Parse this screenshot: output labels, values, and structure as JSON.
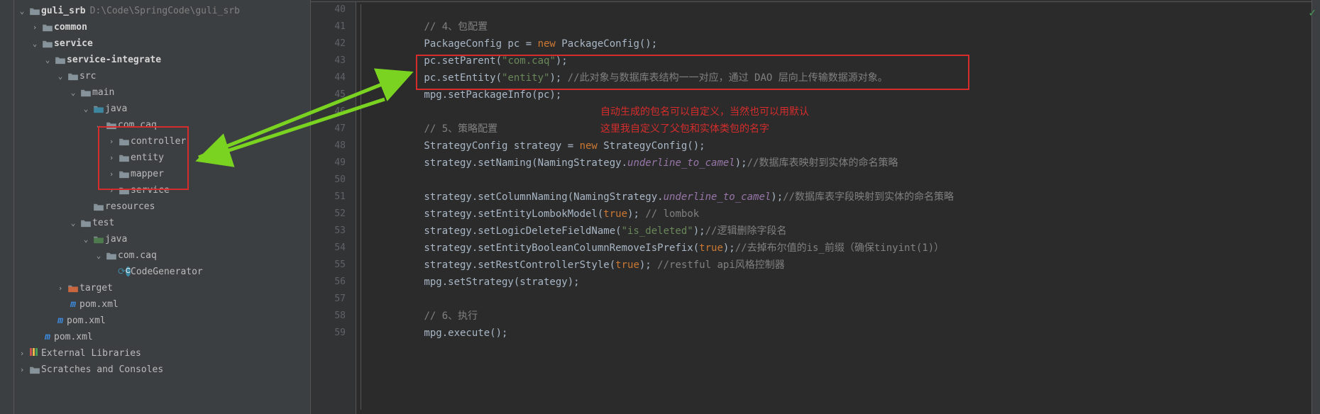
{
  "project": {
    "root_label": "guli_srb",
    "root_path": "D:\\Code\\SpringCode\\guli_srb",
    "items": [
      {
        "depth": 0,
        "arrow": "v",
        "icon": "fld",
        "bold": true,
        "label": "guli_srb",
        "extra": "D:\\Code\\SpringCode\\guli_srb"
      },
      {
        "depth": 1,
        "arrow": ">",
        "icon": "fld",
        "bold": true,
        "label": "common"
      },
      {
        "depth": 1,
        "arrow": "v",
        "icon": "fld",
        "bold": true,
        "label": "service"
      },
      {
        "depth": 2,
        "arrow": "v",
        "icon": "fld",
        "bold": true,
        "label": "service-integrate"
      },
      {
        "depth": 3,
        "arrow": "v",
        "icon": "fld",
        "label": "src"
      },
      {
        "depth": 4,
        "arrow": "v",
        "icon": "fld",
        "label": "main"
      },
      {
        "depth": 5,
        "arrow": "v",
        "icon": "fld-src",
        "label": "java"
      },
      {
        "depth": 6,
        "arrow": "v",
        "icon": "fld-pkg",
        "label": "com.caq"
      },
      {
        "depth": 7,
        "arrow": ">",
        "icon": "fld-pkg",
        "label": "controller"
      },
      {
        "depth": 7,
        "arrow": ">",
        "icon": "fld-pkg",
        "label": "entity"
      },
      {
        "depth": 7,
        "arrow": ">",
        "icon": "fld-pkg",
        "label": "mapper"
      },
      {
        "depth": 7,
        "arrow": ">",
        "icon": "fld-pkg",
        "label": "service"
      },
      {
        "depth": 5,
        "arrow": "",
        "icon": "fld",
        "label": "resources"
      },
      {
        "depth": 4,
        "arrow": "v",
        "icon": "fld",
        "label": "test"
      },
      {
        "depth": 5,
        "arrow": "v",
        "icon": "fld-test",
        "label": "java"
      },
      {
        "depth": 6,
        "arrow": "v",
        "icon": "fld-pkg",
        "label": "com.caq"
      },
      {
        "depth": 7,
        "arrow": "",
        "icon": "cls",
        "label": "CodeGenerator",
        "gear": true
      },
      {
        "depth": 3,
        "arrow": ">",
        "icon": "fld-exclude",
        "label": "target"
      },
      {
        "depth": 3,
        "arrow": "",
        "icon": "m",
        "label": "pom.xml"
      },
      {
        "depth": 2,
        "arrow": "",
        "icon": "m",
        "label": "pom.xml"
      },
      {
        "depth": 1,
        "arrow": "",
        "icon": "m",
        "label": "pom.xml"
      },
      {
        "depth": 0,
        "arrow": ">",
        "icon": "lib",
        "label": "External Libraries"
      },
      {
        "depth": 0,
        "arrow": ">",
        "icon": "scratch",
        "label": "Scratches and Consoles"
      }
    ]
  },
  "editor": {
    "first_line_no": 40,
    "lines": [
      {
        "n": 40,
        "segs": [
          [
            "",
            ""
          ]
        ]
      },
      {
        "n": 41,
        "segs": [
          [
            "k-comment",
            "// 4、包配置"
          ]
        ]
      },
      {
        "n": 42,
        "segs": [
          [
            "",
            "PackageConfig pc = "
          ],
          [
            "k-kw",
            "new "
          ],
          [
            "",
            "PackageConfig();"
          ]
        ]
      },
      {
        "n": 43,
        "segs": [
          [
            "",
            "pc.setParent("
          ],
          [
            "k-str",
            "\"com.caq\""
          ],
          [
            "",
            ");"
          ]
        ]
      },
      {
        "n": 44,
        "segs": [
          [
            "",
            "pc.setEntity("
          ],
          [
            "k-str",
            "\"entity\""
          ],
          [
            "",
            "); "
          ],
          [
            "k-comment",
            "//此对象与数据库表结构一一对应，通过 DAO 层向上传输数据源对象。"
          ]
        ]
      },
      {
        "n": 45,
        "segs": [
          [
            "",
            "mpg.setPackageInfo(pc);"
          ]
        ]
      },
      {
        "n": 46,
        "segs": [
          [
            "",
            ""
          ]
        ],
        "note_a": "自动生成的包名可以自定义，当然也可以用默认"
      },
      {
        "n": 47,
        "segs": [
          [
            "k-comment",
            "// 5、策略配置"
          ]
        ],
        "note_a": "这里我自定义了父包和实体类包的名字"
      },
      {
        "n": 48,
        "segs": [
          [
            "",
            "StrategyConfig strategy = "
          ],
          [
            "k-kw",
            "new "
          ],
          [
            "",
            "StrategyConfig();"
          ]
        ]
      },
      {
        "n": 49,
        "segs": [
          [
            "",
            "strategy.setNaming(NamingStrategy."
          ],
          [
            "k-field",
            "underline_to_camel"
          ],
          [
            "",
            ");"
          ],
          [
            "k-comment",
            "//数据库表映射到实体的命名策略"
          ]
        ]
      },
      {
        "n": 50,
        "segs": [
          [
            "",
            ""
          ]
        ]
      },
      {
        "n": 51,
        "segs": [
          [
            "",
            "strategy.setColumnNaming(NamingStrategy."
          ],
          [
            "k-field",
            "underline_to_camel"
          ],
          [
            "",
            ");"
          ],
          [
            "k-comment",
            "//数据库表字段映射到实体的命名策略"
          ]
        ]
      },
      {
        "n": 52,
        "segs": [
          [
            "",
            "strategy.setEntityLombokModel("
          ],
          [
            "k-kw",
            "true"
          ],
          [
            "",
            "); "
          ],
          [
            "k-comment",
            "// lombok"
          ]
        ]
      },
      {
        "n": 53,
        "segs": [
          [
            "",
            "strategy.setLogicDeleteFieldName("
          ],
          [
            "k-str",
            "\"is_deleted\""
          ],
          [
            "",
            ");"
          ],
          [
            "k-comment",
            "//逻辑删除字段名"
          ]
        ]
      },
      {
        "n": 54,
        "segs": [
          [
            "",
            "strategy.setEntityBooleanColumnRemoveIsPrefix("
          ],
          [
            "k-kw",
            "true"
          ],
          [
            "",
            ");"
          ],
          [
            "k-comment",
            "//去掉布尔值的is_前缀（确保tinyint(1)）"
          ]
        ]
      },
      {
        "n": 55,
        "segs": [
          [
            "",
            "strategy.setRestControllerStyle("
          ],
          [
            "k-kw",
            "true"
          ],
          [
            "",
            "); "
          ],
          [
            "k-comment",
            "//restful api风格控制器"
          ]
        ]
      },
      {
        "n": 56,
        "segs": [
          [
            "",
            "mpg.setStrategy(strategy);"
          ]
        ]
      },
      {
        "n": 57,
        "segs": [
          [
            "",
            ""
          ]
        ]
      },
      {
        "n": 58,
        "segs": [
          [
            "k-comment",
            "// 6、执行"
          ]
        ]
      },
      {
        "n": 59,
        "segs": [
          [
            "",
            "mpg.execute();"
          ]
        ]
      }
    ],
    "red_notes": {
      "a": "自动生成的包名可以自定义，当然也可以用默认",
      "b": "这里我自定义了父包和实体类包的名字"
    }
  }
}
